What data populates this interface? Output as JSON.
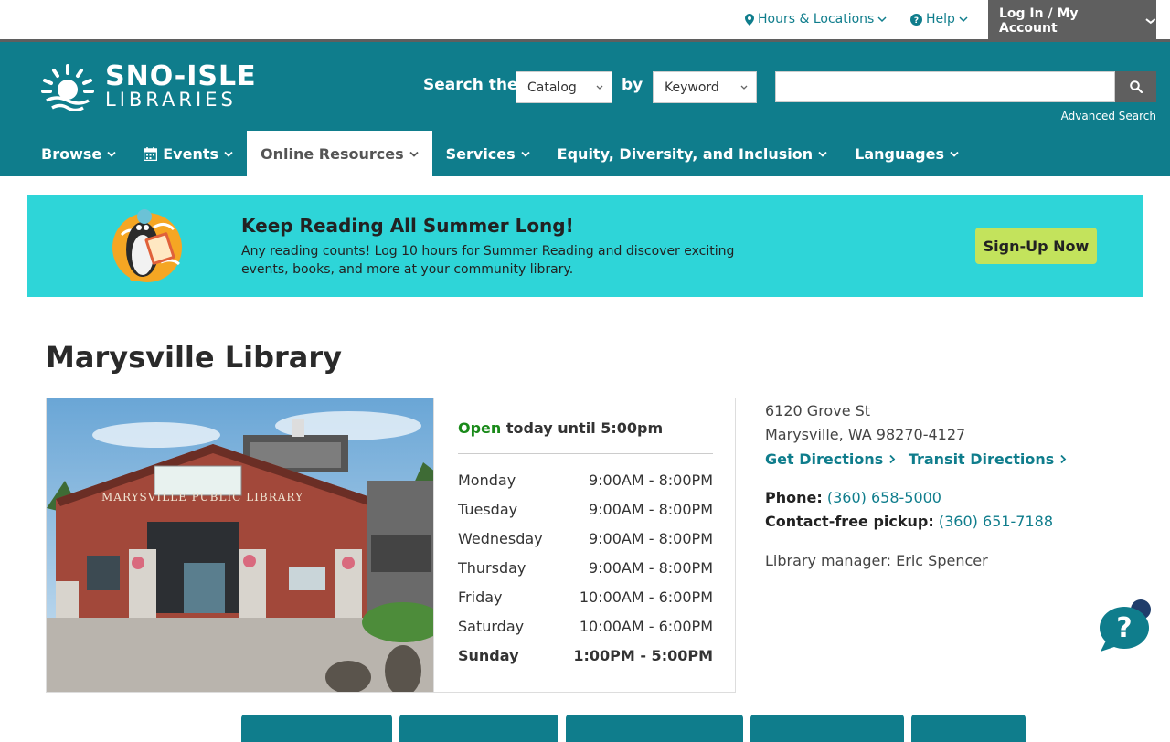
{
  "topbar": {
    "hours_locations": "Hours & Locations",
    "help": "Help",
    "login": "Log In / My Account"
  },
  "header": {
    "logo_line1": "SNO-ISLE",
    "logo_line2": "LIBRARIES",
    "search_the": "Search the",
    "scope_value": "Catalog",
    "by": "by",
    "field_value": "Keyword",
    "search_placeholder": "",
    "advanced_search": "Advanced Search"
  },
  "nav": {
    "items": [
      {
        "label": "Browse",
        "icon": ""
      },
      {
        "label": "Events",
        "icon": "calendar-icon"
      },
      {
        "label": "Online Resources",
        "icon": ""
      },
      {
        "label": "Services",
        "icon": ""
      },
      {
        "label": "Equity, Diversity, and Inclusion",
        "icon": ""
      },
      {
        "label": "Languages",
        "icon": ""
      }
    ],
    "active": "Online Resources"
  },
  "banner": {
    "title": "Keep Reading All Summer Long!",
    "text": "Any reading counts! Log 10 hours for Summer Reading and discover exciting events, books, and more at your community library.",
    "cta": "Sign-Up Now"
  },
  "library": {
    "title": "Marysville Library",
    "photo_sign": "MARYSVILLE PUBLIC LIBRARY",
    "status_open": "Open",
    "status_rest": "today until 5:00pm",
    "hours": [
      {
        "day": "Monday",
        "time": "9:00AM - 8:00PM"
      },
      {
        "day": "Tuesday",
        "time": "9:00AM - 8:00PM"
      },
      {
        "day": "Wednesday",
        "time": "9:00AM - 8:00PM"
      },
      {
        "day": "Thursday",
        "time": "9:00AM - 8:00PM"
      },
      {
        "day": "Friday",
        "time": "10:00AM - 6:00PM"
      },
      {
        "day": "Saturday",
        "time": "10:00AM - 6:00PM"
      },
      {
        "day": "Sunday",
        "time": "1:00PM - 5:00PM"
      }
    ],
    "address1": "6120 Grove St",
    "address2": "Marysville, WA 98270-4127",
    "get_directions": "Get Directions",
    "transit_directions": "Transit Directions",
    "phone_label": "Phone:",
    "phone": "(360) 658-5000",
    "pickup_label": "Contact-free pickup:",
    "pickup_phone": "(360) 651-7188",
    "manager": "Library manager: Eric Spencer"
  },
  "colors": {
    "teal": "#0f7d8c",
    "banner_bg": "#2ed5d8",
    "cta_bg": "#c3e35c",
    "gray": "#5f5f5f",
    "open_green": "#1a8a1a"
  }
}
